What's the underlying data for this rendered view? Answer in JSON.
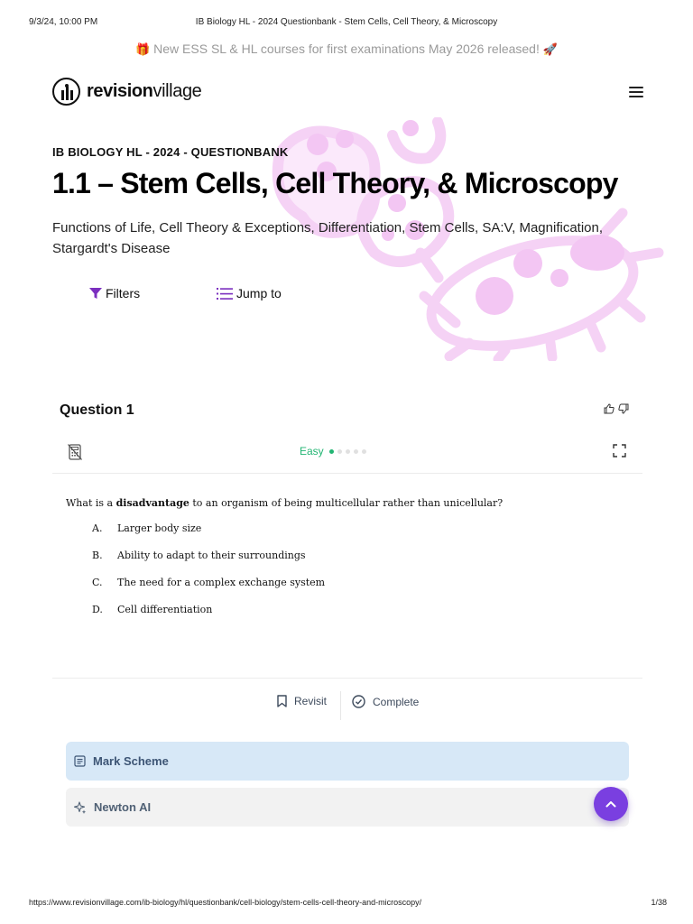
{
  "print": {
    "date": "9/3/24, 10:00 PM",
    "doc_title": "IB Biology HL - 2024 Questionbank - Stem Cells, Cell Theory, & Microscopy",
    "url": "https://www.revisionvillage.com/ib-biology/hl/questionbank/cell-biology/stem-cells-cell-theory-and-microscopy/",
    "page": "1/38"
  },
  "announcement": {
    "emoji_start": "🎁",
    "text": "New ESS SL & HL courses for first examinations May 2026 released!",
    "emoji_end": "🚀"
  },
  "brand": {
    "part1": "revision",
    "part2": "village"
  },
  "header": {
    "eyebrow": "IB BIOLOGY HL - 2024 - QUESTIONBANK",
    "title": "1.1 – Stem Cells, Cell Theory, & Microscopy",
    "subtitle": "Functions of Life, Cell Theory & Exceptions, Differentiation, Stem Cells, SA:V, Magnification, Stargardt's Disease"
  },
  "toolbar": {
    "filters": "Filters",
    "jump_to": "Jump to"
  },
  "question": {
    "title": "Question 1",
    "difficulty": "Easy",
    "difficulty_level": 1,
    "difficulty_max": 5,
    "stem_before": "What is a ",
    "stem_bold": "disadvantage",
    "stem_after": " to an organism of being multicellular rather than unicellular?",
    "options": [
      {
        "letter": "A.",
        "text": "Larger body size"
      },
      {
        "letter": "B.",
        "text": "Ability to adapt to their surroundings"
      },
      {
        "letter": "C.",
        "text": "The need for a complex exchange system"
      },
      {
        "letter": "D.",
        "text": "Cell differentiation"
      }
    ]
  },
  "actions": {
    "revisit": "Revisit",
    "complete": "Complete"
  },
  "panels": {
    "mark_scheme": "Mark Scheme",
    "newton_ai": "Newton AI"
  },
  "colors": {
    "accent": "#7a3fe0",
    "easy": "#22b573",
    "hero_art": "#f5d2f5",
    "mark_scheme_bg": "#d7e8f7"
  }
}
